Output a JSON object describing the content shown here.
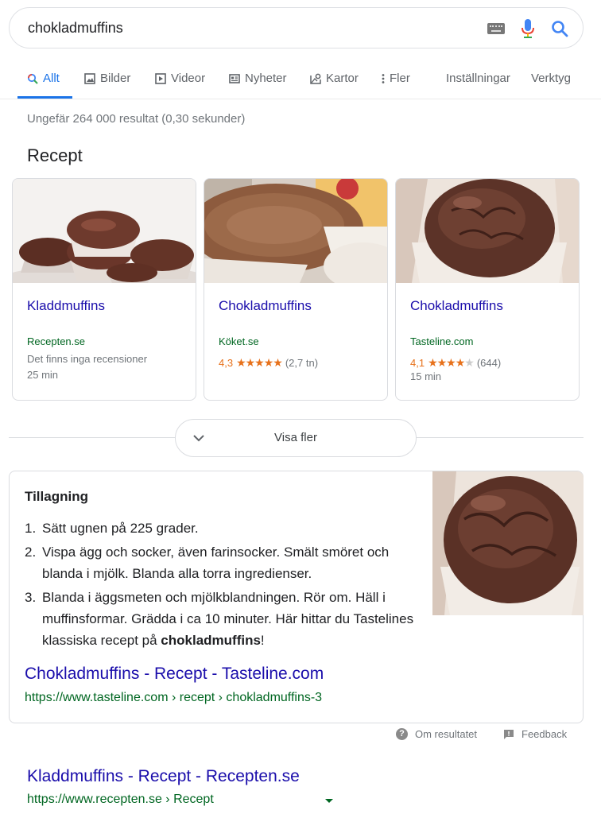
{
  "search": {
    "query": "chokladmuffins"
  },
  "tabs": [
    {
      "label": "Allt",
      "icon": "search-icon"
    },
    {
      "label": "Bilder",
      "icon": "image-icon"
    },
    {
      "label": "Videor",
      "icon": "video-icon"
    },
    {
      "label": "Nyheter",
      "icon": "news-icon"
    },
    {
      "label": "Kartor",
      "icon": "map-icon"
    },
    {
      "label": "Fler",
      "icon": "more-vert-icon"
    }
  ],
  "tools": {
    "settings": "Inställningar",
    "tools": "Verktyg"
  },
  "result_stats": "Ungefär 264 000 resultat (0,30 sekunder)",
  "recipes": {
    "heading": "Recept",
    "cards": [
      {
        "title": "Kladdmuffins",
        "source": "Recepten.se",
        "reviews": "Det finns inga recensioner",
        "time": "25 min"
      },
      {
        "title": "Chokladmuffins",
        "source": "Köket.se",
        "rating": "4,3",
        "stars": 4.3,
        "count": "(2,7 tn)"
      },
      {
        "title": "Chokladmuffins",
        "source": "Tasteline.com",
        "rating": "4,1",
        "stars": 4.1,
        "count": "(644)",
        "time": "15 min"
      }
    ],
    "more_label": "Visa fler"
  },
  "snippet": {
    "heading": "Tillagning",
    "steps": [
      {
        "n": "1.",
        "text": "Sätt ugnen på 225 grader."
      },
      {
        "n": "2.",
        "text": "Vispa ägg och socker, även farinsocker. Smält smöret och blanda i mjölk. Blanda alla torra ingredienser."
      },
      {
        "n": "3.",
        "text": "Blanda i äggsmeten och mjölkblandningen. Rör om. Häll i muffinsformar. Grädda i ca 10 minuter. Här hittar du Tastelines klassiska recept på ",
        "bold": "chokladmuffins",
        "after": "!"
      }
    ],
    "link_title": "Chokladmuffins - Recept - Tasteline.com",
    "url": "https://www.tasteline.com › recept › chokladmuffins-3"
  },
  "feedback": {
    "about": "Om resultatet",
    "feedback": "Feedback"
  },
  "result2": {
    "title": "Kladdmuffins - Recept - Recepten.se",
    "url": "https://www.recepten.se › Recept"
  }
}
